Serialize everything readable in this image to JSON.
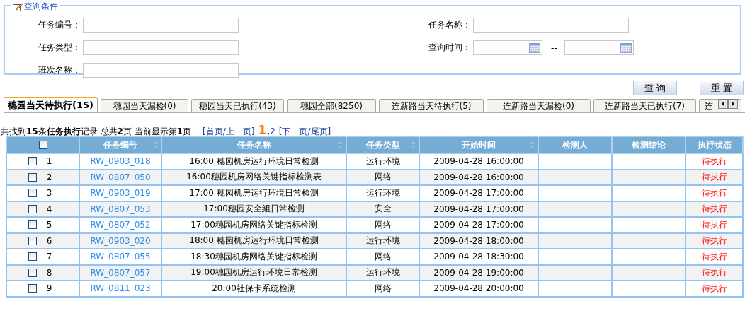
{
  "query_panel": {
    "legend": "查询条件",
    "fields": [
      {
        "label": "任务编号：",
        "kind": "text"
      },
      {
        "label": "任务名称：",
        "kind": "text"
      },
      {
        "label": "任务类型：",
        "kind": "text"
      },
      {
        "label": "查询时间：",
        "kind": "date_range",
        "separator": "--"
      },
      {
        "label": "班次名称：",
        "kind": "text"
      }
    ],
    "buttons": [
      "查 询",
      "重 置"
    ]
  },
  "tabs": [
    {
      "label": "穗园当天待执行(15)",
      "selected": true
    },
    {
      "label": "穗园当天漏检(0)",
      "selected": false
    },
    {
      "label": "穗园当天已执行(43)",
      "selected": false
    },
    {
      "label": "穗园全部(8250)",
      "selected": false
    },
    {
      "label": "连新路当天待执行(5)",
      "selected": false
    },
    {
      "label": "连新路当天漏检(0)",
      "selected": false
    },
    {
      "label": "连新路当天已执行(7)",
      "selected": false
    },
    {
      "label": "连",
      "selected": false
    }
  ],
  "pager": {
    "summary": "共找到**15**条**任务执行**记录  总共**2**页 当前显示第**1**页",
    "prev": "[首页/上一页]",
    "pages": [
      {
        "label": "1",
        "selected": true
      },
      {
        "label": "2",
        "selected": false
      }
    ],
    "separator": ",",
    "next": "[下一页/尾页]"
  },
  "table": {
    "select_all": {
      "checked": false
    },
    "columns": [
      "任务编号",
      "任务名称",
      "任务类型",
      "开始时间",
      "检测人",
      "检测结论",
      "执行状态"
    ],
    "sortable": [
      true,
      true,
      true,
      true,
      false,
      false,
      false
    ],
    "rows": [
      {
        "checked": false,
        "index": "1",
        "id": "RW_0903_018",
        "name": "16:00 穗园机房运行环境日常检测",
        "type": "运行环境",
        "start": "2009-04-28 16:00:00",
        "status": "待执行"
      },
      {
        "checked": false,
        "index": "2",
        "id": "RW_0807_050",
        "name": "16:00穗园机房网络关键指标检测表",
        "type": "网络",
        "start": "2009-04-28 16:00:00",
        "status": "待执行"
      },
      {
        "checked": false,
        "index": "3",
        "id": "RW_0903_019",
        "name": "17:00 穗园机房运行环境日常检测",
        "type": "运行环境",
        "start": "2009-04-28 17:00:00",
        "status": "待执行"
      },
      {
        "checked": false,
        "index": "4",
        "id": "RW_0807_053",
        "name": "17:00穗园安全組日常检测",
        "type": "安全",
        "start": "2009-04-28 17:00:00",
        "status": "待执行"
      },
      {
        "checked": false,
        "index": "5",
        "id": "RW_0807_052",
        "name": "17:00穗园机房网络关键指标检测",
        "type": "网络",
        "start": "2009-04-28 17:00:00",
        "status": "待执行"
      },
      {
        "checked": false,
        "index": "6",
        "id": "RW_0903_020",
        "name": "18:00 穗园机房运行环境日常检测",
        "type": "运行环境",
        "start": "2009-04-28 18:00:00",
        "status": "待执行"
      },
      {
        "checked": false,
        "index": "7",
        "id": "RW_0807_055",
        "name": "18:30穗园机房网络关键指标检测",
        "type": "网络",
        "start": "2009-04-28 18:30:00",
        "status": "待执行"
      },
      {
        "checked": false,
        "index": "8",
        "id": "RW_0807_057",
        "name": "19:00穗园机房运行环境日常检测",
        "type": "运行环境",
        "start": "2009-04-28 19:00:00",
        "status": "待执行"
      },
      {
        "checked": false,
        "index": "9",
        "id": "RW_0811_023",
        "name": "20:00社保卡系统检测",
        "type": "网络",
        "start": "2009-04-28 20:00:00",
        "status": "待执行"
      }
    ]
  }
}
